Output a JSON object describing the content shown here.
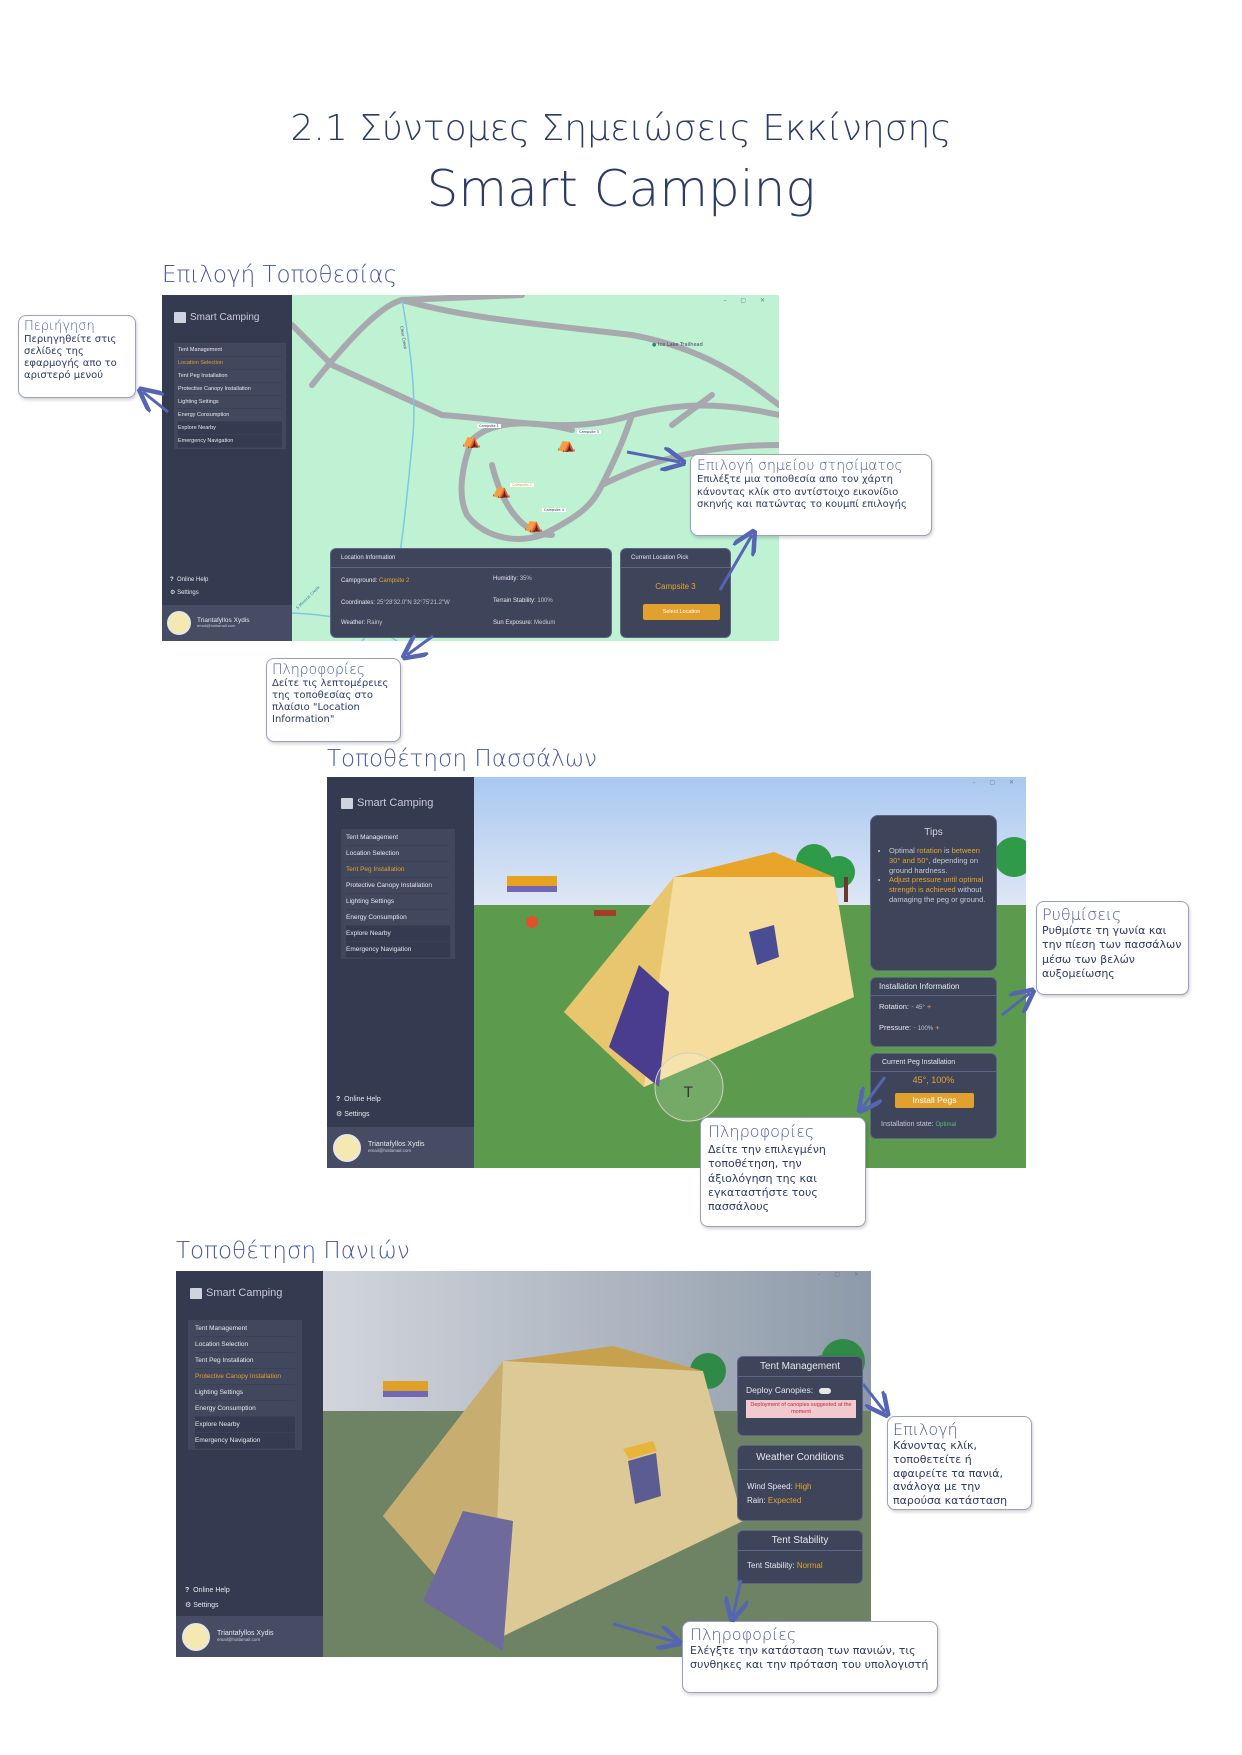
{
  "header": {
    "subtitle": "2.1  Σύντομες Σημειώσεις Εκκίνησης",
    "title": "Smart Camping"
  },
  "app": {
    "logo": "Smart Camping",
    "menu": [
      "Tent Management",
      "Location Selection",
      "Tent Peg Installation",
      "Protective Canopy Installation",
      "Lighting Settings",
      "Energy Consumption",
      "Explore Nearby",
      "Emergency Navigation"
    ],
    "online_help": "Online Help",
    "settings": "Settings",
    "user_name": "Triantafyllos Xydis",
    "user_email": "email@hotlamail.com",
    "window_controls": "– ▢ ✕"
  },
  "section1": {
    "title": "Επιλογή Τοποθεσίας",
    "map_labels": {
      "creek": "Clear Creek",
      "trailhead": "Ice Lake Trailhead",
      "mineral_creek": "S Mineral Creek",
      "camp1": "Campsite 1",
      "camp2": "Campsite 2",
      "camp3": "Campsite 3",
      "camp4": "Campsite 4"
    },
    "location_info": {
      "title": "Location Information",
      "campground_label": "Campground:",
      "campground": "Campsite 2",
      "coordinates_label": "Coordinates:",
      "coordinates": "25°28'32.0\"N 32°75'21.2\"W",
      "weather_label": "Weather:",
      "weather": "Rainy",
      "humidity_label": "Humidity:",
      "humidity": "35%",
      "terrain_label": "Terrain Stability:",
      "terrain": "100%",
      "sun_label": "Sun Exposure:",
      "sun": "Medium"
    },
    "pick": {
      "title": "Current Location Pick",
      "value": "Campsite 3",
      "button": "Select Location"
    },
    "callout_nav": {
      "title": "Περιήγηση",
      "text": "Περιηγηθείτε στις σελίδες της εφαρμογής απο το αριστερό μενού"
    },
    "callout_pick": {
      "title": "Επιλογή σημείου στησίματος",
      "text": "Επιλέξτε μια τοποθεσία απο τον χάρτη κάνοντας κλίκ στο αντίστοιχο εικονίδιο σκηνής και πατώντας το κουμπί επιλογής"
    },
    "callout_info": {
      "title": "Πληροφορίες",
      "text": "Δείτε τις λεπτομέρειες της τοποθεσίας στο πλαίσιο \"Location Information\""
    }
  },
  "section2": {
    "title": "Τοποθέτηση Πασσάλων",
    "tips": {
      "title": "Tips",
      "t1a": "Optimal ",
      "t1b": "rotation",
      "t1c": " is ",
      "t1d": "between 30° and 50°",
      "t1e": ", depending on ground hardness.",
      "t2a": "Adjust pressure until optimal strength is achieved",
      "t2b": " without damaging the peg or ground."
    },
    "install_info": {
      "title": "Installation Information",
      "rotation_label": "Rotation:",
      "rotation": "45°",
      "pressure_label": "Pressure:",
      "pressure": "100%"
    },
    "current_peg": {
      "title": "Current Peg Installation",
      "value": "45°, 100%",
      "button": "Install Pegs",
      "state_label": "Installation state:",
      "state": "Optimal"
    },
    "callout_settings": {
      "title": "Ρυθμίσεις",
      "text": "Ρυθμίστε τη γωνία και την πίεση των πασσάλων μέσω των βελών αυξομείωσης"
    },
    "callout_info": {
      "title": "Πληροφορίες",
      "text": "Δείτε την επιλεγμένη τοποθέτηση, την άξιολόγηση της και εγκαταστήστε τους πασσάλους"
    }
  },
  "section3": {
    "title": "Τοποθέτηση Πανιών",
    "tent_mgmt": {
      "title": "Tent Management",
      "deploy_label": "Deploy Canopies:",
      "warning": "Deployment of canopies suggested at the moment"
    },
    "weather": {
      "title": "Weather Conditions",
      "wind_label": "Wind Speed:",
      "wind": "High",
      "rain_label": "Rain:",
      "rain": "Expected"
    },
    "stability": {
      "title": "Tent Stability",
      "label": "Tent Stability:",
      "value": "Normal"
    },
    "callout_choice": {
      "title": "Επιλογή",
      "text": "Κάνοντας κλίκ, τοποθετείτε ή αφαιρείτε τα πανιά, ανάλογα με την παρούσα κατάσταση"
    },
    "callout_info": {
      "title": "Πληροφορίες",
      "text": "Ελέγξτε την κατάσταση των πανιών, τις συνθηκες και την πρόταση του υπολογιστή"
    }
  },
  "colors": {
    "accent": "#e4a12a",
    "sidebar": "#343a4f",
    "map": "#bff1d3",
    "title": "#2c3a66",
    "callout_title": "#4654a0"
  }
}
